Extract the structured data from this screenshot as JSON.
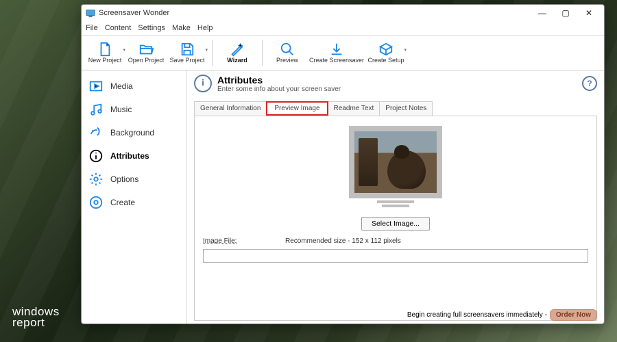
{
  "app": {
    "title": "Screensaver Wonder"
  },
  "menu": {
    "file": "File",
    "content": "Content",
    "settings": "Settings",
    "make": "Make",
    "help": "Help"
  },
  "toolbar": {
    "new": "New Project",
    "open": "Open Project",
    "save": "Save Project",
    "wizard": "Wizard",
    "preview": "Preview",
    "createss": "Create Screensaver",
    "setup": "Create Setup"
  },
  "sidebar": {
    "items": [
      {
        "label": "Media"
      },
      {
        "label": "Music"
      },
      {
        "label": "Background"
      },
      {
        "label": "Attributes"
      },
      {
        "label": "Options"
      },
      {
        "label": "Create"
      }
    ]
  },
  "panel": {
    "title": "Attributes",
    "subtitle": "Enter some info about your screen saver",
    "tabs": {
      "general": "General Information",
      "preview": "Preview Image",
      "readme": "Readme Text",
      "notes": "Project Notes"
    },
    "select_btn": "Select Image...",
    "image_file_lbl": "Image File:",
    "hint": "Recommended size - 152 x 112 pixels",
    "image_file_value": ""
  },
  "footer": {
    "text": "Begin creating full screensavers immediately -",
    "cta": "Order Now"
  },
  "watermark": {
    "line1": "windows",
    "line2": "report"
  }
}
